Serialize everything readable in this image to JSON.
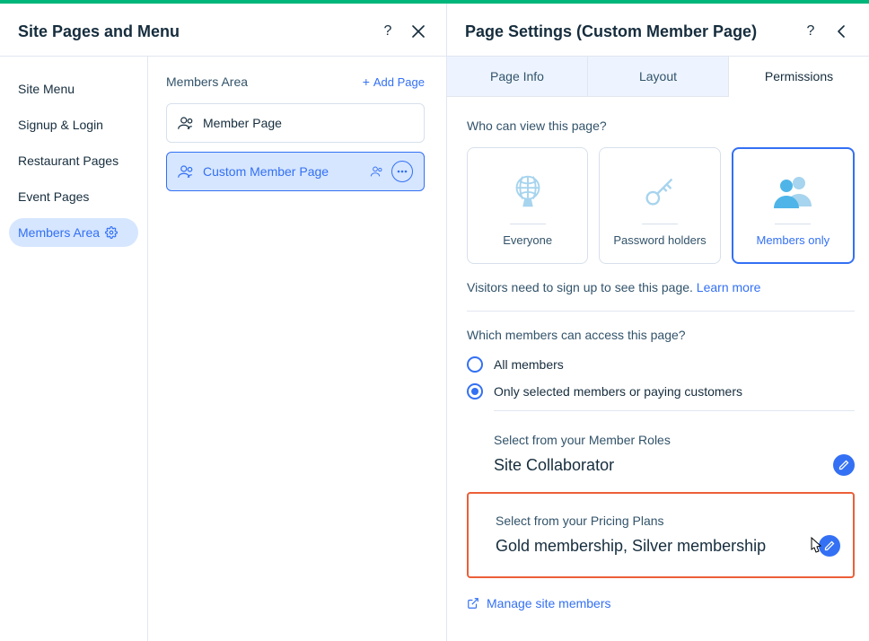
{
  "left_panel": {
    "title": "Site Pages and Menu",
    "sidebar": {
      "items": [
        {
          "label": "Site Menu"
        },
        {
          "label": "Signup & Login"
        },
        {
          "label": "Restaurant Pages"
        },
        {
          "label": "Event Pages"
        },
        {
          "label": "Members Area"
        }
      ]
    },
    "content": {
      "section_title": "Members Area",
      "add_page": "Add Page",
      "pages": [
        {
          "label": "Member Page"
        },
        {
          "label": "Custom Member Page"
        }
      ]
    }
  },
  "right_panel": {
    "title": "Page Settings (Custom Member Page)",
    "tabs": [
      {
        "label": "Page Info"
      },
      {
        "label": "Layout"
      },
      {
        "label": "Permissions"
      }
    ],
    "who_can_view": {
      "question": "Who can view this page?",
      "options": [
        {
          "label": "Everyone"
        },
        {
          "label": "Password holders"
        },
        {
          "label": "Members only"
        }
      ],
      "hint_prefix": "Visitors need to sign up to see this page. ",
      "hint_link": "Learn more"
    },
    "which_members": {
      "question": "Which members can access this page?",
      "options": [
        {
          "label": "All members"
        },
        {
          "label": "Only selected members or paying customers"
        }
      ]
    },
    "member_roles": {
      "label": "Select from your Member Roles",
      "value": "Site Collaborator"
    },
    "pricing_plans": {
      "label": "Select from your Pricing Plans",
      "value": "Gold membership, Silver membership"
    },
    "manage_link": "Manage site members"
  }
}
